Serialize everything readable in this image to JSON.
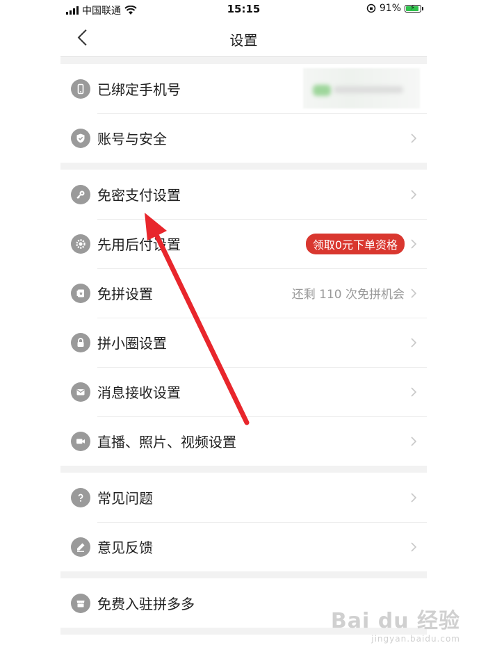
{
  "status_bar": {
    "carrier": "中国联通",
    "time": "15:15",
    "battery": "91%"
  },
  "nav": {
    "title": "设置",
    "back_icon": "chevron-left-icon"
  },
  "groups": [
    {
      "items": [
        {
          "label": "已绑定手机号",
          "icon": "phone-icon"
        },
        {
          "label": "账号与安全",
          "icon": "shield-icon"
        }
      ]
    },
    {
      "items": [
        {
          "label": "免密支付设置",
          "icon": "key-icon"
        },
        {
          "label": "先用后付设置",
          "icon": "gear-badge-icon",
          "badge": "领取0元下单资格"
        },
        {
          "label": "免拼设置",
          "icon": "card-icon",
          "extra": "还剩 110 次免拼机会"
        },
        {
          "label": "拼小圈设置",
          "icon": "lock-icon"
        },
        {
          "label": "消息接收设置",
          "icon": "mail-icon"
        },
        {
          "label": "直播、照片、视频设置",
          "icon": "video-icon"
        }
      ]
    },
    {
      "items": [
        {
          "label": "常见问题",
          "icon": "question-icon"
        },
        {
          "label": "意见反馈",
          "icon": "pencil-icon"
        }
      ]
    },
    {
      "items": [
        {
          "label": "免费入驻拼多多",
          "icon": "store-icon"
        }
      ]
    }
  ],
  "watermark": {
    "main": "Bai du 经验",
    "sub": "jingyan.baidu.com"
  },
  "colors": {
    "badge": "#d9372f",
    "arrow": "#e8262c",
    "icon_bg": "#9a9a9a"
  }
}
